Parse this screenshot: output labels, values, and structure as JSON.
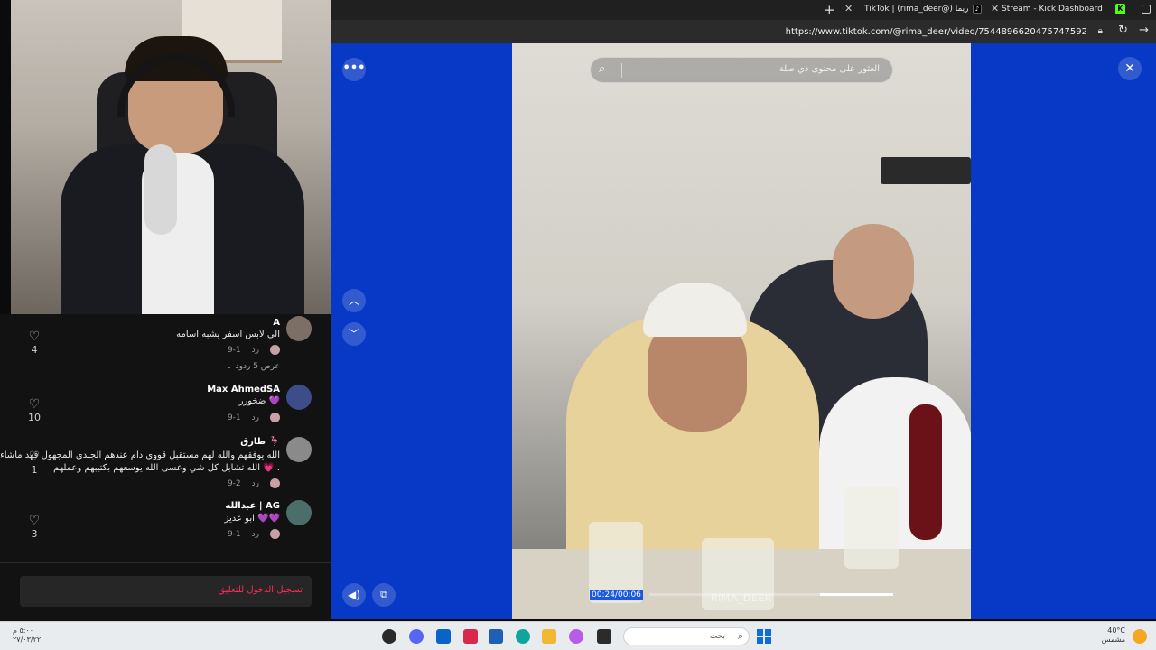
{
  "browser": {
    "tabs": [
      {
        "title": "TikTok | (rima_deer@) ريما"
      },
      {
        "title": "Stream - Kick Dashboard"
      }
    ],
    "url": "https://www.tiktok.com/@rima_deer/video/7544896620475747592"
  },
  "viewer": {
    "search_placeholder": "العثور على محتوى ذي صلة",
    "time": "00:24/00:06",
    "watermark": "RIMA_DEER",
    "progress_percent": 30
  },
  "comments": [
    {
      "name": "A",
      "text": "الي لابس اسفر يشبه اسامه",
      "date": "9-1",
      "reply": "رد",
      "likes": "4",
      "view_replies": "عرض 5 ردود"
    },
    {
      "name": "Max AhmedSA",
      "text": "ضخورر 💜",
      "date": "9-1",
      "reply": "رد",
      "likes": "10"
    },
    {
      "name": "طارق 🦩",
      "text": "الله يوفقهم والله لهم مستقبل قووي دام عندهم الجندي المجهول فهد ماشاء",
      "text2": "الله تشابل كل شي وعسى الله يوسعهم بكتيبهم وعملهم 💗 .",
      "date": "9-2",
      "reply": "رد",
      "likes": "1"
    },
    {
      "name": "عبدالله | AG",
      "text": "ابو عديز 💜💜",
      "date": "9-1",
      "reply": "رد",
      "likes": "3"
    }
  ],
  "login": {
    "label": "تسجيل الدخول للتعليق"
  },
  "taskbar": {
    "clock_time": "٥:٠٠ م",
    "clock_date": "٢٧/٠٣/٢٢",
    "search_placeholder": "بحث",
    "temperature": "40°C",
    "weather": "مشمس"
  },
  "colors": {
    "viewer_bg": "#0738c6",
    "tiktok_red": "#fe2c55",
    "kick_green": "#53fc18"
  }
}
